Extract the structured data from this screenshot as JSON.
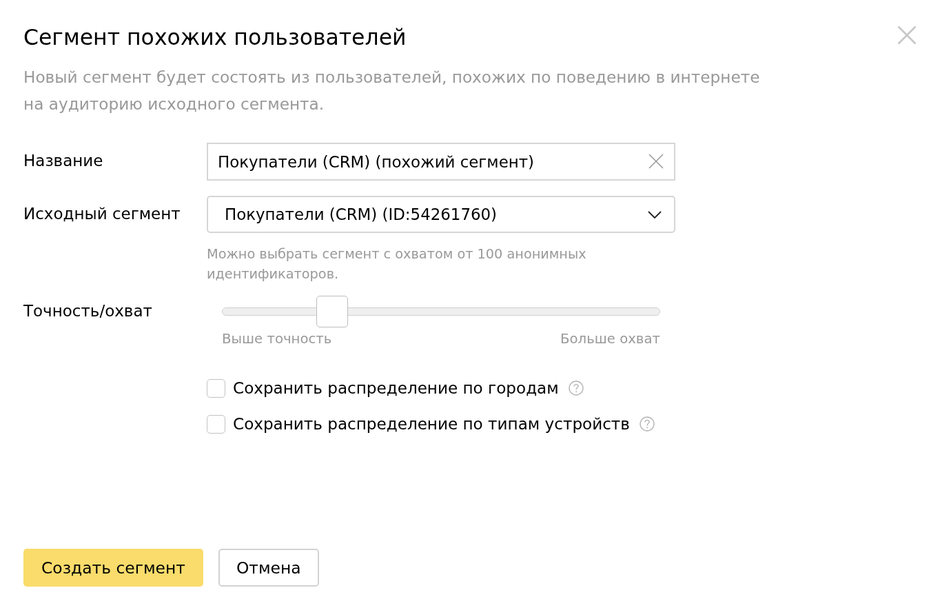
{
  "dialog": {
    "title": "Сегмент похожих пользователей",
    "description": "Новый сегмент будет состоять из пользователей, похожих по поведению в интернете на аудиторию исходного сегмента."
  },
  "fields": [
    {
      "kind": "text",
      "label": "Название",
      "value": "Покупатели (CRM) (похожий сегмент)"
    },
    {
      "kind": "select",
      "label": "Исходный сегмент",
      "value": "Покупатели (CRM) (ID:54261760)",
      "hint": "Можно выбрать сегмент с охватом от 100 анонимных идентификаторов."
    },
    {
      "kind": "slider",
      "label": "Точность/охват",
      "level": 0.25,
      "min_label": "Выше точность",
      "max_label": "Больше охват"
    }
  ],
  "options": [
    {
      "label": "Сохранить распределение по городам",
      "checked": false
    },
    {
      "label": "Сохранить распределение по типам устройств",
      "checked": false
    }
  ],
  "buttons": [
    {
      "label": "Создать сегмент",
      "kind": "primary"
    },
    {
      "label": "Отмена",
      "kind": "secondary"
    }
  ]
}
